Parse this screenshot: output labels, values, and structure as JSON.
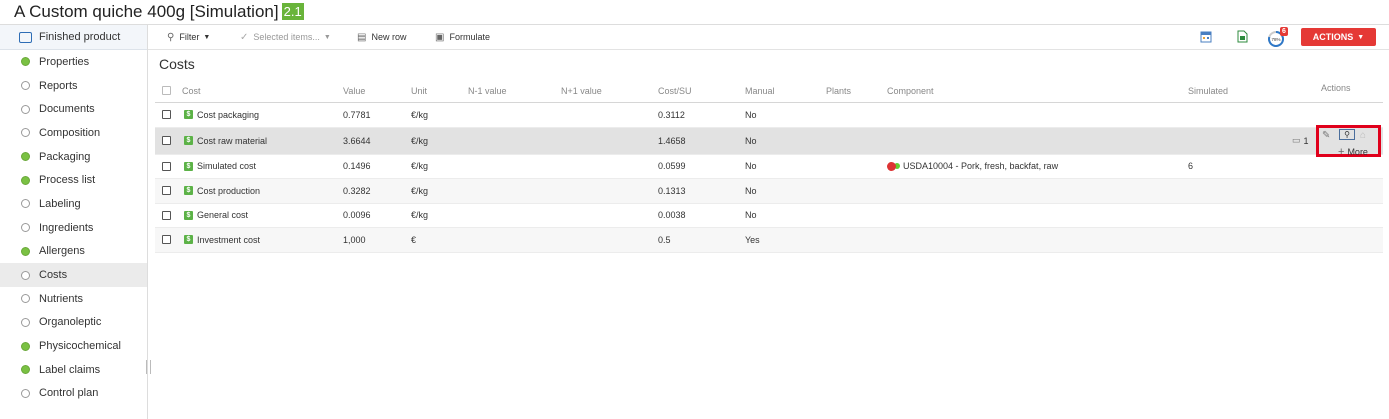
{
  "page": {
    "title": "A Custom quiche 400g [Simulation]",
    "version": "2.1"
  },
  "sidebar": {
    "header": "Finished product",
    "items": [
      {
        "label": "Properties",
        "filled": true
      },
      {
        "label": "Reports",
        "filled": false
      },
      {
        "label": "Documents",
        "filled": false
      },
      {
        "label": "Composition",
        "filled": false
      },
      {
        "label": "Packaging",
        "filled": true
      },
      {
        "label": "Process list",
        "filled": true
      },
      {
        "label": "Labeling",
        "filled": false
      },
      {
        "label": "Ingredients",
        "filled": false
      },
      {
        "label": "Allergens",
        "filled": true
      },
      {
        "label": "Costs",
        "filled": false,
        "active": true
      },
      {
        "label": "Nutrients",
        "filled": false
      },
      {
        "label": "Organoleptic",
        "filled": false
      },
      {
        "label": "Physicochemical",
        "filled": true
      },
      {
        "label": "Label claims",
        "filled": true
      },
      {
        "label": "Control plan",
        "filled": false
      }
    ]
  },
  "toolbar": {
    "filter": "Filter",
    "selected_items": "Selected items...",
    "new_row": "New row",
    "formulate": "Formulate",
    "notification_count": "6",
    "actions": "ACTIONS"
  },
  "section": {
    "title": "Costs"
  },
  "table": {
    "headers": {
      "cost": "Cost",
      "value": "Value",
      "unit": "Unit",
      "n_minus_1": "N-1 value",
      "n_plus_1": "N+1 value",
      "cost_su": "Cost/SU",
      "manual": "Manual",
      "plants": "Plants",
      "component": "Component",
      "simulated": "Simulated",
      "actions": "Actions"
    },
    "rows": [
      {
        "cost": "Cost packaging",
        "value": "0.7781",
        "unit": "€/kg",
        "cost_su": "0.3112",
        "manual": "No",
        "component": "",
        "simulated": ""
      },
      {
        "cost": "Cost raw material",
        "value": "3.6644",
        "unit": "€/kg",
        "cost_su": "1.4658",
        "manual": "No",
        "component": "",
        "simulated": "",
        "hover": true
      },
      {
        "cost": "Simulated cost",
        "value": "0.1496",
        "unit": "€/kg",
        "cost_su": "0.0599",
        "manual": "No",
        "component": "USDA10004 - Pork, fresh, backfat, raw",
        "simulated": "6"
      },
      {
        "cost": "Cost production",
        "value": "0.3282",
        "unit": "€/kg",
        "cost_su": "0.1313",
        "manual": "No",
        "component": "",
        "simulated": ""
      },
      {
        "cost": "General cost",
        "value": "0.0096",
        "unit": "€/kg",
        "cost_su": "0.0038",
        "manual": "No",
        "component": "",
        "simulated": ""
      },
      {
        "cost": "Investment cost",
        "value": "1,000",
        "unit": "€",
        "cost_su": "0.5",
        "manual": "Yes",
        "component": "",
        "simulated": ""
      }
    ],
    "badge_glyph": "$",
    "hover_row": {
      "comment_count": "1",
      "more": "More"
    }
  }
}
